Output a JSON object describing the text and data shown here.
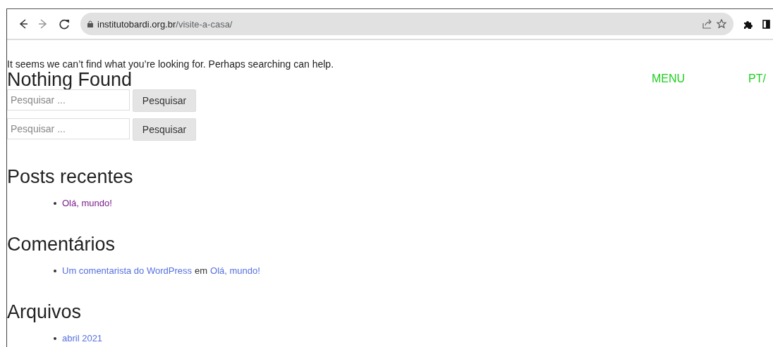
{
  "browser": {
    "url_host": "institutobardi.org.br",
    "url_path": "/visite-a-casa/"
  },
  "header_links": [
    {
      "label": "MENU"
    },
    {
      "label": "PT/"
    }
  ],
  "message": "It seems we can’t find what you’re looking for. Perhaps searching can help.",
  "title": "Nothing Found",
  "search_forms": [
    {
      "placeholder": "Pesquisar ...",
      "button": "Pesquisar"
    },
    {
      "placeholder": "Pesquisar ...",
      "button": "Pesquisar"
    }
  ],
  "widgets": [
    {
      "title": "Posts recentes",
      "items": [
        {
          "parts": [
            {
              "kind": "link",
              "text": "Olá, mundo!",
              "visited": true
            }
          ]
        }
      ]
    },
    {
      "title": "Comentários",
      "items": [
        {
          "parts": [
            {
              "kind": "link",
              "text": "Um comentarista do WordPress",
              "visited": false
            },
            {
              "kind": "text",
              "text": "em"
            },
            {
              "kind": "link",
              "text": "Olá, mundo!",
              "visited": false
            }
          ]
        }
      ]
    },
    {
      "title": "Arquivos",
      "items": [
        {
          "parts": [
            {
              "kind": "link",
              "text": "abril 2021",
              "visited": false
            }
          ]
        }
      ]
    }
  ]
}
